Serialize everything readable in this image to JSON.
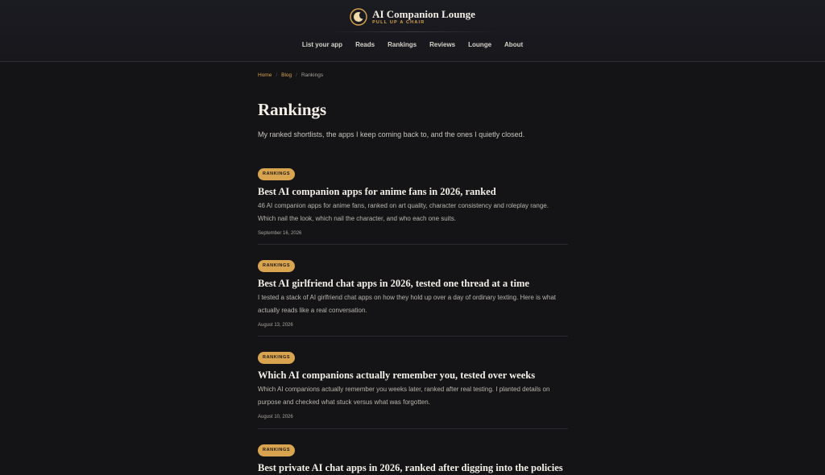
{
  "brand": {
    "title": "AI Companion Lounge",
    "tagline": "PULL UP A CHAIR",
    "icon": "moon-icon",
    "accent": "#d9a44f"
  },
  "nav": {
    "items": [
      "List your app",
      "Reads",
      "Rankings",
      "Reviews",
      "Lounge",
      "About"
    ]
  },
  "breadcrumb": {
    "home": "Home",
    "blog": "Blog",
    "current": "Rankings"
  },
  "page": {
    "title": "Rankings",
    "lede": "My ranked shortlists, the apps I keep coming back to, and the ones I quietly closed."
  },
  "posts": [
    {
      "badge": "RANKINGS",
      "title": "Best AI companion apps for anime fans in 2026, ranked",
      "excerpt": "46 AI companion apps for anime fans, ranked on art quality, character consistency and roleplay range. Which nail the look, which nail the character, and who each one suits.",
      "date": "September 16, 2026"
    },
    {
      "badge": "RANKINGS",
      "title": "Best AI girlfriend chat apps in 2026, tested one thread at a time",
      "excerpt": "I tested a stack of AI girlfriend chat apps on how they hold up over a day of ordinary texting. Here is what actually reads like a real conversation.",
      "date": "August 13, 2026"
    },
    {
      "badge": "RANKINGS",
      "title": "Which AI companions actually remember you, tested over weeks",
      "excerpt": "Which AI companions actually remember you weeks later, ranked after real testing. I planted details on purpose and checked what stuck versus what was forgotten.",
      "date": "August 10, 2026"
    },
    {
      "badge": "RANKINGS",
      "title": "Best private AI chat apps in 2026, ranked after digging into the policies"
    }
  ]
}
